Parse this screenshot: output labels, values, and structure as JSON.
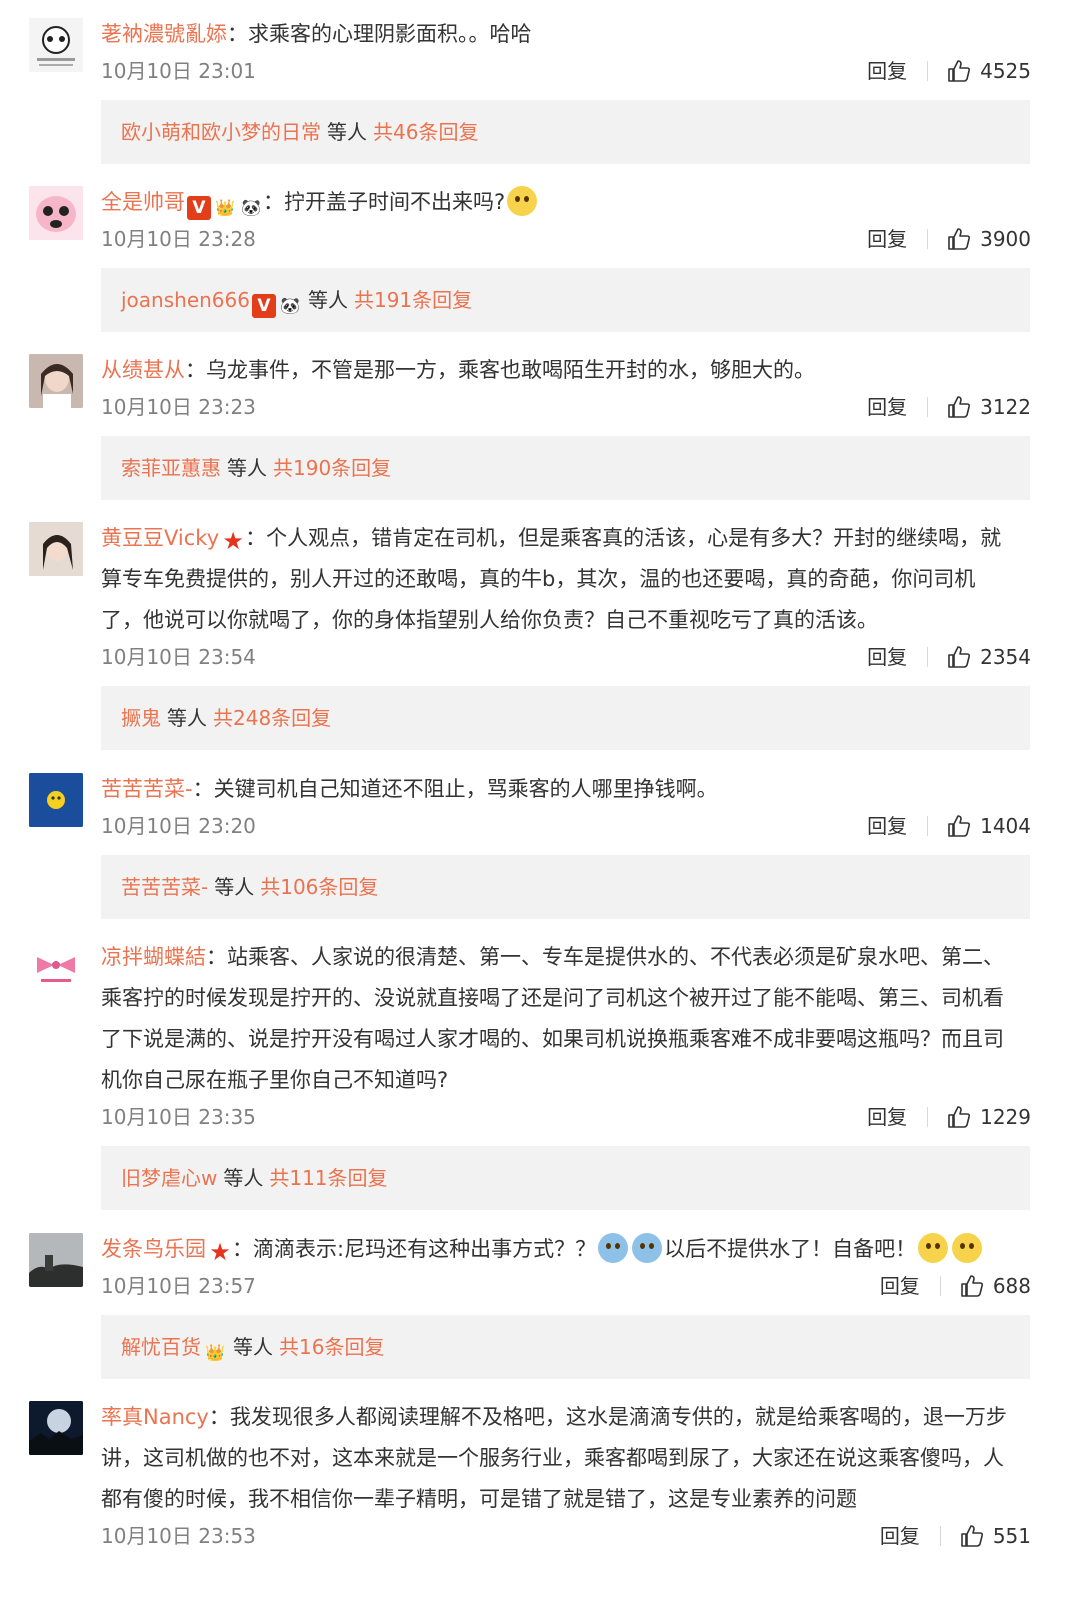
{
  "comments": [
    {
      "name": "荖衲濃號亂婖",
      "badges": [],
      "sep": "：",
      "lines": [
        "求乘客的心理阴影面积。。哈哈"
      ],
      "time": "10月10日 23:01",
      "reply_label": "回复",
      "likes": "4525",
      "avatar": {
        "icon": "panda-meme-avatar",
        "bg": "#f4f4f4"
      },
      "replies": {
        "name": "欧小萌和欧小梦的日常",
        "badges": [],
        "mid": "等人",
        "count": "共46条回复"
      }
    },
    {
      "name": "全是帅哥",
      "badges": [
        "V",
        "👑",
        "🐼"
      ],
      "sep": "：",
      "lines": [
        "拧开盖子时间不出来吗?"
      ],
      "trail_emoji": [
        "laugh-cry-emoji"
      ],
      "time": "10月10日 23:28",
      "reply_label": "回复",
      "likes": "3900",
      "avatar": {
        "icon": "pink-panda-avatar",
        "bg": "#fbe4ec"
      },
      "replies": {
        "name": "joanshen666",
        "badges": [
          "V",
          "🐼"
        ],
        "mid": "等人",
        "count": "共191条回复"
      }
    },
    {
      "name": "从绩甚从",
      "badges": [],
      "sep": "：",
      "lines": [
        "乌龙事件，不管是那一方，乘客也敢喝陌生开封的水，够胆大的。"
      ],
      "time": "10月10日 23:23",
      "reply_label": "回复",
      "likes": "3122",
      "avatar": {
        "icon": "girl-photo-avatar",
        "bg": "#c9b8b0"
      },
      "replies": {
        "name": "索菲亚蕙惠",
        "badges": [],
        "mid": "等人",
        "count": "共190条回复"
      }
    },
    {
      "name": "黄豆豆Vicky",
      "badges": [
        "★"
      ],
      "sep": "：",
      "lines": [
        "个人观点，错肯定在司机，但是乘客真的活该，心是有多大？开封的继续喝，就",
        "算专车免费提供的，别人开过的还敢喝，真的牛b，其次，温的也还要喝，真的奇葩，你问司机",
        "了，他说可以你就喝了，你的身体指望别人给你负责？自己不重视吃亏了真的活该。"
      ],
      "time": "10月10日 23:54",
      "reply_label": "回复",
      "likes": "2354",
      "avatar": {
        "icon": "woman-photo-avatar",
        "bg": "#d8c8bc"
      },
      "replies": {
        "name": "撅鬼",
        "badges": [],
        "mid": "等人",
        "count": "共248条回复"
      }
    },
    {
      "name": "苦苦苦菜-",
      "badges": [],
      "sep": "：",
      "lines": [
        "关键司机自己知道还不阻止，骂乘客的人哪里挣钱啊。"
      ],
      "time": "10月10日 23:20",
      "reply_label": "回复",
      "likes": "1404",
      "avatar": {
        "icon": "blue-sky-avatar",
        "bg": "#1a4d9c"
      },
      "replies": {
        "name": "苦苦苦菜-",
        "badges": [],
        "mid": "等人",
        "count": "共106条回复"
      }
    },
    {
      "name": "凉拌蝴蝶結",
      "badges": [],
      "sep": "：",
      "lines": [
        "站乘客、人家说的很清楚、第一、专车是提供水的、不代表必须是矿泉水吧、第二、",
        "乘客拧的时候发现是拧开的、没说就直接喝了还是问了司机这个被开过了能不能喝、第三、司机看",
        "了下说是满的、说是拧开没有喝过人家才喝的、如果司机说换瓶乘客难不成非要喝这瓶吗？而且司",
        "机你自己尿在瓶子里你自己不知道吗?"
      ],
      "time": "10月10日 23:35",
      "reply_label": "回复",
      "likes": "1229",
      "avatar": {
        "icon": "pink-bow-avatar",
        "bg": "#ffffff"
      },
      "replies": {
        "name": "旧梦虐心w",
        "badges": [],
        "mid": "等人",
        "count": "共111条回复"
      }
    },
    {
      "name": "发条鸟乐园",
      "badges": [
        "★"
      ],
      "sep": "：",
      "lines": [
        "滴滴表示:尼玛还有这种出事方式？？"
      ],
      "mid_emoji": [
        "shocked-emoji",
        "shocked-emoji"
      ],
      "lines_after": "以后不提供水了！自备吧！",
      "trail_emoji": [
        "laugh-emoji",
        "laugh-emoji"
      ],
      "time": "10月10日 23:57",
      "reply_label": "回复",
      "likes": "688",
      "avatar": {
        "icon": "dark-landscape-avatar",
        "bg": "#9aa0a4"
      },
      "replies": {
        "name": "解忧百货",
        "badges": [
          "👑"
        ],
        "mid": "等人",
        "count": "共16条回复"
      }
    },
    {
      "name": "率真Nancy",
      "badges": [],
      "sep": "：",
      "lines": [
        "我发现很多人都阅读理解不及格吧，这水是滴滴专供的，就是给乘客喝的，退一万步",
        "讲，这司机做的也不对，这本来就是一个服务行业，乘客都喝到尿了，大家还在说这乘客傻吗，人",
        "都有傻的时候，我不相信你一辈子精明，可是错了就是错了，这是专业素养的问题"
      ],
      "time": "10月10日 23:53",
      "reply_label": "回复",
      "likes": "551",
      "avatar": {
        "icon": "moon-night-avatar",
        "bg": "#0d1a2e"
      }
    }
  ]
}
